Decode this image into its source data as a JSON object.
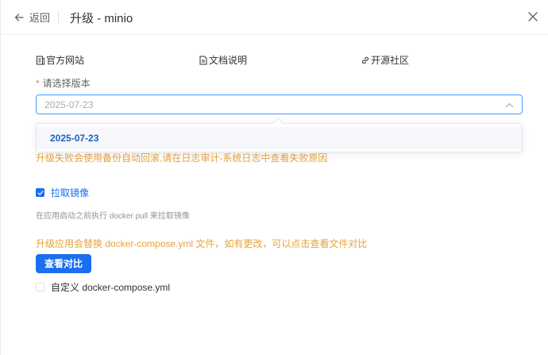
{
  "header": {
    "back_label": "返回",
    "title": "升级 - minio"
  },
  "links": [
    {
      "label": "官方网站",
      "icon": "document-icon"
    },
    {
      "label": "文档说明",
      "icon": "file-icon"
    },
    {
      "label": "开源社区",
      "icon": "link-icon"
    }
  ],
  "form": {
    "version_label": "请选择版本",
    "version_value": "2025-07-23",
    "options": [
      "2025-07-23"
    ],
    "rollback_warning": "升级失败会使用备份自动回滚,请在日志审计-系统日志中查看失败原因",
    "pull_label": "拉取镜像",
    "pull_checked": true,
    "pull_help": "在应用启动之前执行 docker pull 来拉取镜像",
    "compose_warning": "升级应用会替换 docker-compose.yml 文件，如有更改，可以点击查看文件对比",
    "diff_button": "查看对比",
    "custom_label": "自定义 docker-compose.yml",
    "custom_checked": false
  },
  "colors": {
    "primary": "#1a6ff0",
    "warning": "#e6a23c",
    "required": "#f56c6c"
  }
}
